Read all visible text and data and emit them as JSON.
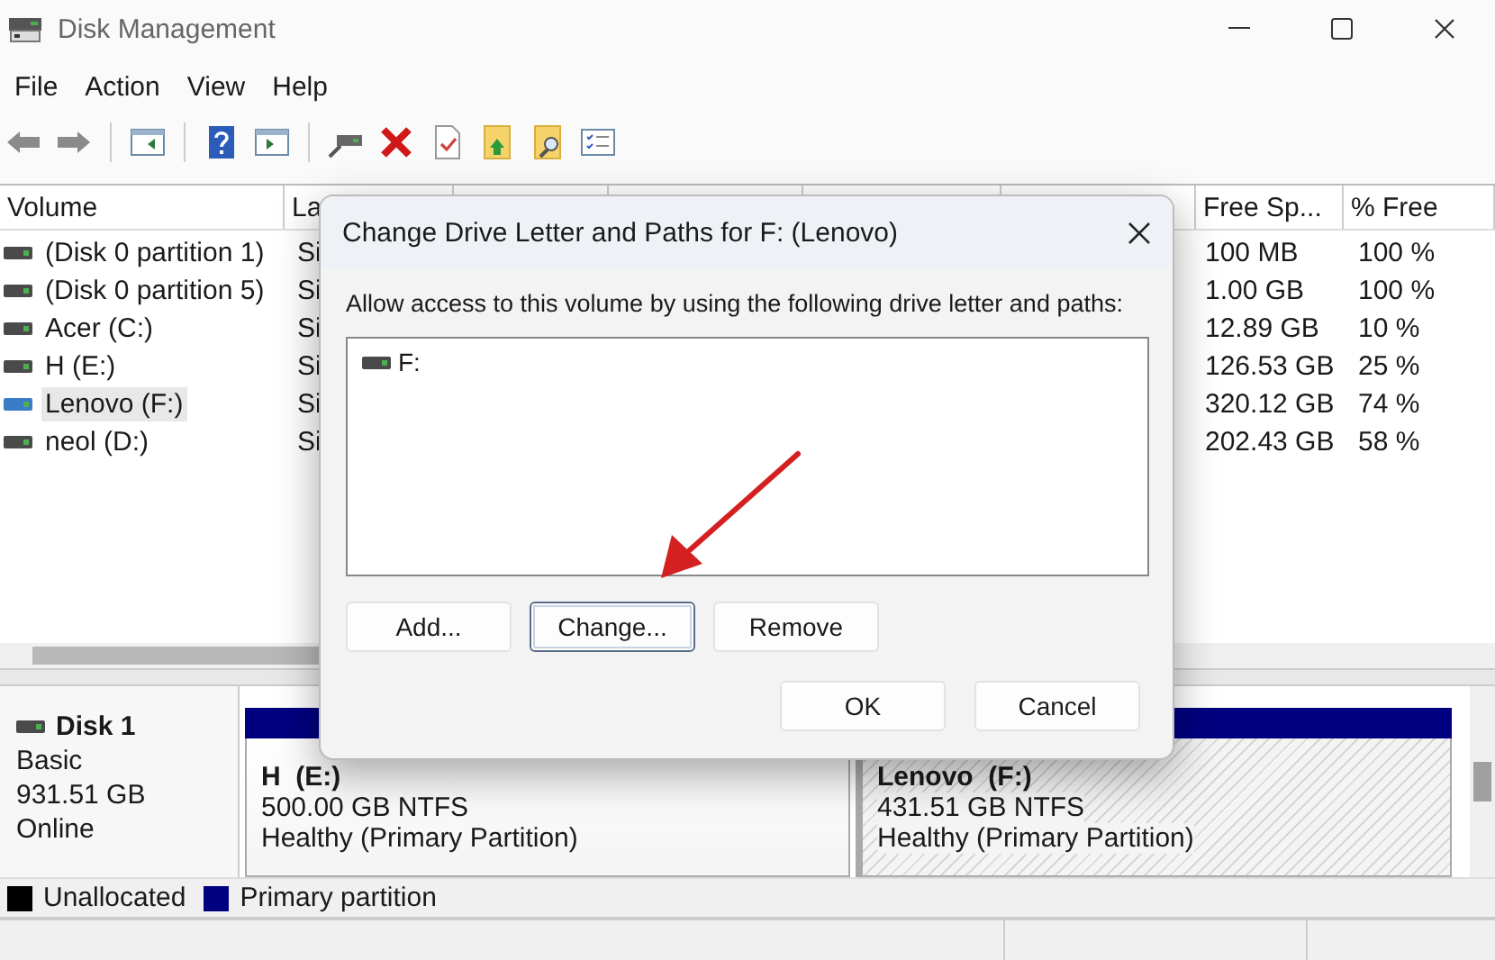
{
  "window": {
    "title": "Disk Management"
  },
  "menu": [
    {
      "label": "File"
    },
    {
      "label": "Action"
    },
    {
      "label": "View"
    },
    {
      "label": "Help"
    }
  ],
  "volumes": {
    "columns": [
      {
        "label": "Volume"
      },
      {
        "label": "La"
      },
      {},
      {},
      {},
      {},
      {
        "label": "Free Sp..."
      },
      {
        "label": "% Free"
      }
    ],
    "rows": [
      {
        "name": "(Disk 0 partition 1)",
        "layout": "Si",
        "free": "100 MB",
        "percent_free": "100 %",
        "selected": false
      },
      {
        "name": "(Disk 0 partition 5)",
        "layout": "Si",
        "free": "1.00 GB",
        "percent_free": "100 %",
        "selected": false
      },
      {
        "name": "Acer (C:)",
        "layout": "Si",
        "free": "12.89 GB",
        "percent_free": "10 %",
        "selected": false
      },
      {
        "name": "H (E:)",
        "layout": "Si",
        "free": "126.53 GB",
        "percent_free": "25 %",
        "selected": false
      },
      {
        "name": "Lenovo (F:)",
        "layout": "Si",
        "free": "320.12 GB",
        "percent_free": "74 %",
        "selected": true
      },
      {
        "name": "neol (D:)",
        "layout": "Si",
        "free": "202.43 GB",
        "percent_free": "58 %",
        "selected": false
      }
    ]
  },
  "disk": {
    "name": "Disk 1",
    "type": "Basic",
    "size": "931.51 GB",
    "status": "Online",
    "partitions": [
      {
        "name": "H  (E:)",
        "size": "500.00 GB NTFS",
        "status": "Healthy (Primary Partition)",
        "selected": false
      },
      {
        "name": "Lenovo  (F:)",
        "size": "431.51 GB NTFS",
        "status": "Healthy (Primary Partition)",
        "selected": true
      }
    ]
  },
  "legend": [
    {
      "label": "Unallocated",
      "color": "#000000"
    },
    {
      "label": "Primary partition",
      "color": "#000080"
    }
  ],
  "dialog": {
    "title": "Change Drive Letter and Paths for F: (Lenovo)",
    "prompt": "Allow access to this volume by using the following drive letter and paths:",
    "paths": [
      {
        "label": "F:"
      }
    ],
    "buttons": [
      {
        "label": "Add...",
        "focused": false
      },
      {
        "label": "Change...",
        "focused": true
      },
      {
        "label": "Remove",
        "focused": false
      }
    ],
    "footer_buttons": [
      {
        "label": "OK"
      },
      {
        "label": "Cancel"
      }
    ]
  }
}
